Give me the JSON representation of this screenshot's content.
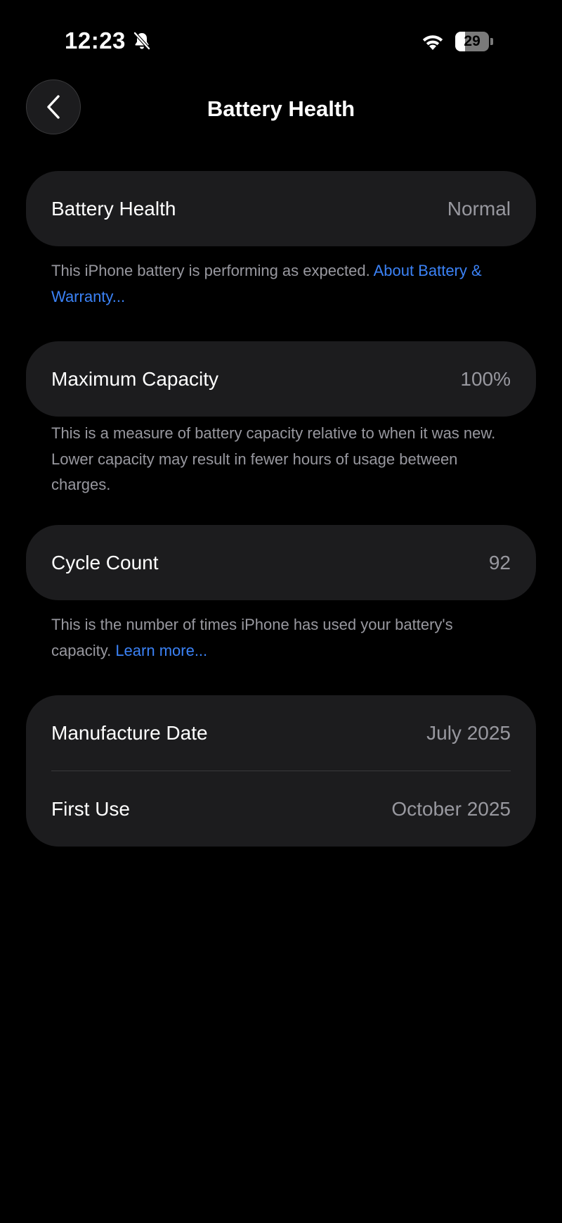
{
  "status_bar": {
    "time": "12:23",
    "battery_level": "29",
    "battery_fraction": 0.29,
    "icons": [
      "bell-slash-icon",
      "wifi-icon",
      "battery-icon"
    ]
  },
  "nav": {
    "title": "Battery Health",
    "back_icon": "chevron-left-icon"
  },
  "sections": {
    "health": {
      "label": "Battery Health",
      "value": "Normal",
      "footnote_text": "This iPhone battery is performing as expected. ",
      "footnote_link": "About Battery & Warranty..."
    },
    "capacity": {
      "label": "Maximum Capacity",
      "value": "100%",
      "footnote_text": "This is a measure of battery capacity relative to when it was new. Lower capacity may result in fewer hours of usage between charges."
    },
    "cycles": {
      "label": "Cycle Count",
      "value": "92",
      "footnote_text": "This is the number of times iPhone has used your battery's capacity. ",
      "footnote_link": "Learn more..."
    },
    "dates": {
      "manufacture_label": "Manufacture Date",
      "manufacture_value": "July 2025",
      "first_use_label": "First Use",
      "first_use_value": "October 2025"
    }
  },
  "colors": {
    "background": "#000000",
    "card": "#1c1c1e",
    "secondary_text": "#98989f",
    "link": "#3b82f6"
  }
}
